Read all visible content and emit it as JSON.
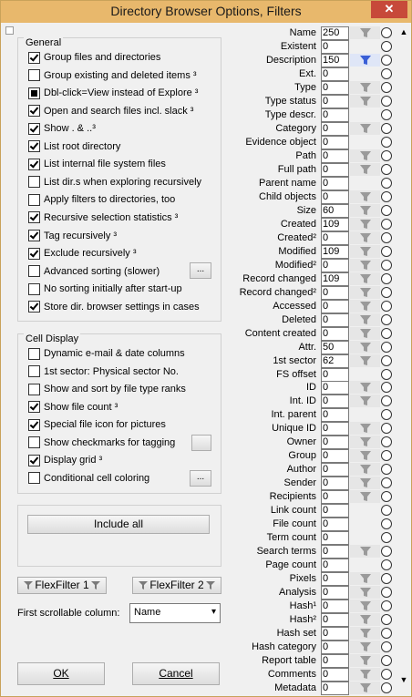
{
  "window": {
    "title": "Directory Browser Options, Filters",
    "close": "✕"
  },
  "general": {
    "title": "General",
    "items": [
      {
        "label": "Group files and directories",
        "checked": true
      },
      {
        "label": "Group existing and deleted items ³",
        "checked": false
      },
      {
        "label": "Dbl-click=View instead of Explore ³",
        "checked": "partial"
      },
      {
        "label": "Open and search files incl. slack ³",
        "checked": true
      },
      {
        "label": "Show . & ..³",
        "checked": true
      },
      {
        "label": "List root directory",
        "checked": true
      },
      {
        "label": "List internal file system files",
        "checked": true
      },
      {
        "label": "List dir.s when exploring recursively",
        "checked": false
      },
      {
        "label": "Apply filters to directories, too",
        "checked": false
      },
      {
        "label": "Recursive selection statistics ³",
        "checked": true
      },
      {
        "label": "Tag recursively ³",
        "checked": true
      },
      {
        "label": "Exclude recursively ³",
        "checked": true
      },
      {
        "label": "Advanced sorting (slower)",
        "checked": false
      },
      {
        "label": "No sorting initially after start-up",
        "checked": false
      },
      {
        "label": "Store dir. browser settings in cases",
        "checked": true
      }
    ],
    "advanced_more": "..."
  },
  "cell_display": {
    "title": "Cell Display",
    "items": [
      {
        "label": "Dynamic e-mail & date columns",
        "checked": false
      },
      {
        "label": "1st sector: Physical sector No.",
        "checked": false
      },
      {
        "label": "Show and sort by file type ranks",
        "checked": false
      },
      {
        "label": "Show file count ³",
        "checked": true
      },
      {
        "label": "Special file icon for pictures",
        "checked": true
      },
      {
        "label": "Show checkmarks for tagging",
        "checked": false
      },
      {
        "label": "Display grid ³",
        "checked": true
      },
      {
        "label": "Conditional cell coloring",
        "checked": false
      }
    ],
    "coloring_more": "..."
  },
  "include_all": "Include all",
  "flexfilter1": "FlexFilter 1",
  "flexfilter2": "FlexFilter 2",
  "first_scrollable": {
    "label": "First scrollable column:",
    "value": "Name"
  },
  "ok": "OK",
  "cancel": "Cancel",
  "columns": [
    {
      "label": "Name",
      "width": "250",
      "filter": true,
      "active": false
    },
    {
      "label": "Existent",
      "width": "0",
      "filter": false
    },
    {
      "label": "Description",
      "width": "150",
      "filter": true,
      "active": true
    },
    {
      "label": "Ext.",
      "width": "0",
      "filter": false
    },
    {
      "label": "Type",
      "width": "0",
      "filter": true
    },
    {
      "label": "Type status",
      "width": "0",
      "filter": true
    },
    {
      "label": "Type descr.",
      "width": "0",
      "filter": false
    },
    {
      "label": "Category",
      "width": "0",
      "filter": true
    },
    {
      "label": "Evidence object",
      "width": "0",
      "filter": false
    },
    {
      "label": "Path",
      "width": "0",
      "filter": true
    },
    {
      "label": "Full path",
      "width": "0",
      "filter": true
    },
    {
      "label": "Parent name",
      "width": "0",
      "filter": false
    },
    {
      "label": "Child objects",
      "width": "0",
      "filter": true
    },
    {
      "label": "Size",
      "width": "60",
      "filter": true
    },
    {
      "label": "Created",
      "width": "109",
      "filter": true
    },
    {
      "label": "Created²",
      "width": "0",
      "filter": true
    },
    {
      "label": "Modified",
      "width": "109",
      "filter": true
    },
    {
      "label": "Modified²",
      "width": "0",
      "filter": true
    },
    {
      "label": "Record changed",
      "width": "109",
      "filter": true
    },
    {
      "label": "Record changed²",
      "width": "0",
      "filter": true
    },
    {
      "label": "Accessed",
      "width": "0",
      "filter": true
    },
    {
      "label": "Deleted",
      "width": "0",
      "filter": true
    },
    {
      "label": "Content created",
      "width": "0",
      "filter": true
    },
    {
      "label": "Attr.",
      "width": "50",
      "filter": true
    },
    {
      "label": "1st sector",
      "width": "62",
      "filter": true
    },
    {
      "label": "FS offset",
      "width": "0",
      "filter": false
    },
    {
      "label": "ID",
      "width": "0",
      "filter": true
    },
    {
      "label": "Int. ID",
      "width": "0",
      "filter": true
    },
    {
      "label": "Int. parent",
      "width": "0",
      "filter": false
    },
    {
      "label": "Unique ID",
      "width": "0",
      "filter": true
    },
    {
      "label": "Owner",
      "width": "0",
      "filter": true
    },
    {
      "label": "Group",
      "width": "0",
      "filter": true
    },
    {
      "label": "Author",
      "width": "0",
      "filter": true
    },
    {
      "label": "Sender",
      "width": "0",
      "filter": true
    },
    {
      "label": "Recipients",
      "width": "0",
      "filter": true
    },
    {
      "label": "Link count",
      "width": "0",
      "filter": false
    },
    {
      "label": "File count",
      "width": "0",
      "filter": false
    },
    {
      "label": "Term count",
      "width": "0",
      "filter": false
    },
    {
      "label": "Search terms",
      "width": "0",
      "filter": true
    },
    {
      "label": "Page count",
      "width": "0",
      "filter": false
    },
    {
      "label": "Pixels",
      "width": "0",
      "filter": true
    },
    {
      "label": "Analysis",
      "width": "0",
      "filter": true
    },
    {
      "label": "Hash¹",
      "width": "0",
      "filter": true
    },
    {
      "label": "Hash²",
      "width": "0",
      "filter": true
    },
    {
      "label": "Hash set",
      "width": "0",
      "filter": true
    },
    {
      "label": "Hash category",
      "width": "0",
      "filter": true
    },
    {
      "label": "Report table",
      "width": "0",
      "filter": true
    },
    {
      "label": "Comments",
      "width": "0",
      "filter": true
    },
    {
      "label": "Metadata",
      "width": "0",
      "filter": true
    }
  ],
  "colors": {
    "titlebar": "#e8b86c",
    "close": "#c7493a",
    "filter_active": "#3a5fd6"
  }
}
